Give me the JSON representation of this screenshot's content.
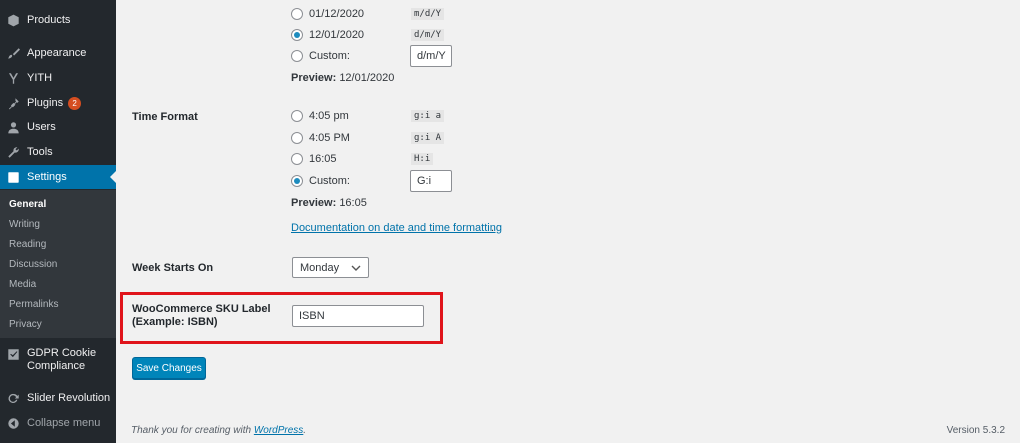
{
  "sidebar": {
    "items": [
      {
        "label": "Products",
        "icon": "box-icon"
      },
      {
        "label": "Appearance",
        "icon": "paintbrush-icon"
      },
      {
        "label": "YITH",
        "icon": "yith-icon"
      },
      {
        "label": "Plugins",
        "icon": "plug-icon",
        "badge": "2"
      },
      {
        "label": "Users",
        "icon": "user-icon"
      },
      {
        "label": "Tools",
        "icon": "wrench-icon"
      },
      {
        "label": "Settings",
        "icon": "settings-icon"
      },
      {
        "label": "GDPR Cookie Compliance",
        "icon": "checkbox-icon"
      },
      {
        "label": "Slider Revolution",
        "icon": "refresh-icon"
      },
      {
        "label": "Collapse menu",
        "icon": "collapse-icon"
      }
    ],
    "submenu": [
      "General",
      "Writing",
      "Reading",
      "Discussion",
      "Media",
      "Permalinks",
      "Privacy"
    ]
  },
  "date_format": {
    "options": [
      {
        "label": "01/12/2020",
        "code": "m/d/Y",
        "checked": false
      },
      {
        "label": "12/01/2020",
        "code": "d/m/Y",
        "checked": true
      }
    ],
    "custom_label": "Custom:",
    "custom_value": "d/m/Y",
    "preview_label": "Preview:",
    "preview_value": "12/01/2020"
  },
  "time_format": {
    "label": "Time Format",
    "options": [
      {
        "label": "4:05 pm",
        "code": "g:i a",
        "checked": false
      },
      {
        "label": "4:05 PM",
        "code": "g:i A",
        "checked": false
      },
      {
        "label": "16:05",
        "code": "H:i",
        "checked": false
      }
    ],
    "custom_label": "Custom:",
    "custom_value": "G:i",
    "preview_label": "Preview:",
    "preview_value": "16:05",
    "doc_link": "Documentation on date and time formatting"
  },
  "week_starts": {
    "label": "Week Starts On",
    "value": "Monday"
  },
  "sku": {
    "label": "WooCommerce SKU Label (Example: ISBN)",
    "value": "ISBN"
  },
  "save_label": "Save Changes",
  "footer": {
    "thanks_prefix": "Thank you for creating with ",
    "link": "WordPress",
    "suffix": ".",
    "version": "Version 5.3.2"
  },
  "colors": {
    "accent": "#0073aa",
    "sidebar": "#23282d",
    "highlight": "#e0141b",
    "badge": "#d54e21"
  }
}
